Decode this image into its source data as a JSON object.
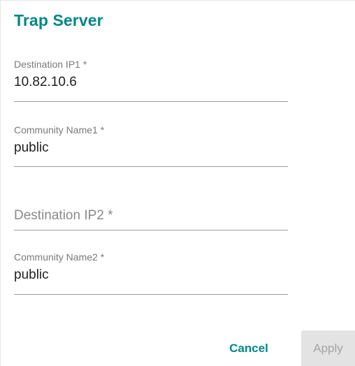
{
  "dialog": {
    "title": "Trap Server"
  },
  "fields": [
    {
      "label": "Destination IP1 *",
      "value": "10.82.10.6"
    },
    {
      "label": "Community Name1 *",
      "value": "public"
    },
    {
      "label": "Destination IP2 *",
      "value": ""
    },
    {
      "label": "Community Name2 *",
      "value": "public"
    }
  ],
  "actions": {
    "cancel_label": "Cancel",
    "apply_label": "Apply",
    "apply_disabled": true
  },
  "colors": {
    "accent": "#008787",
    "disabled_bg": "#e3e3e3",
    "disabled_text": "#a3a3a3"
  }
}
